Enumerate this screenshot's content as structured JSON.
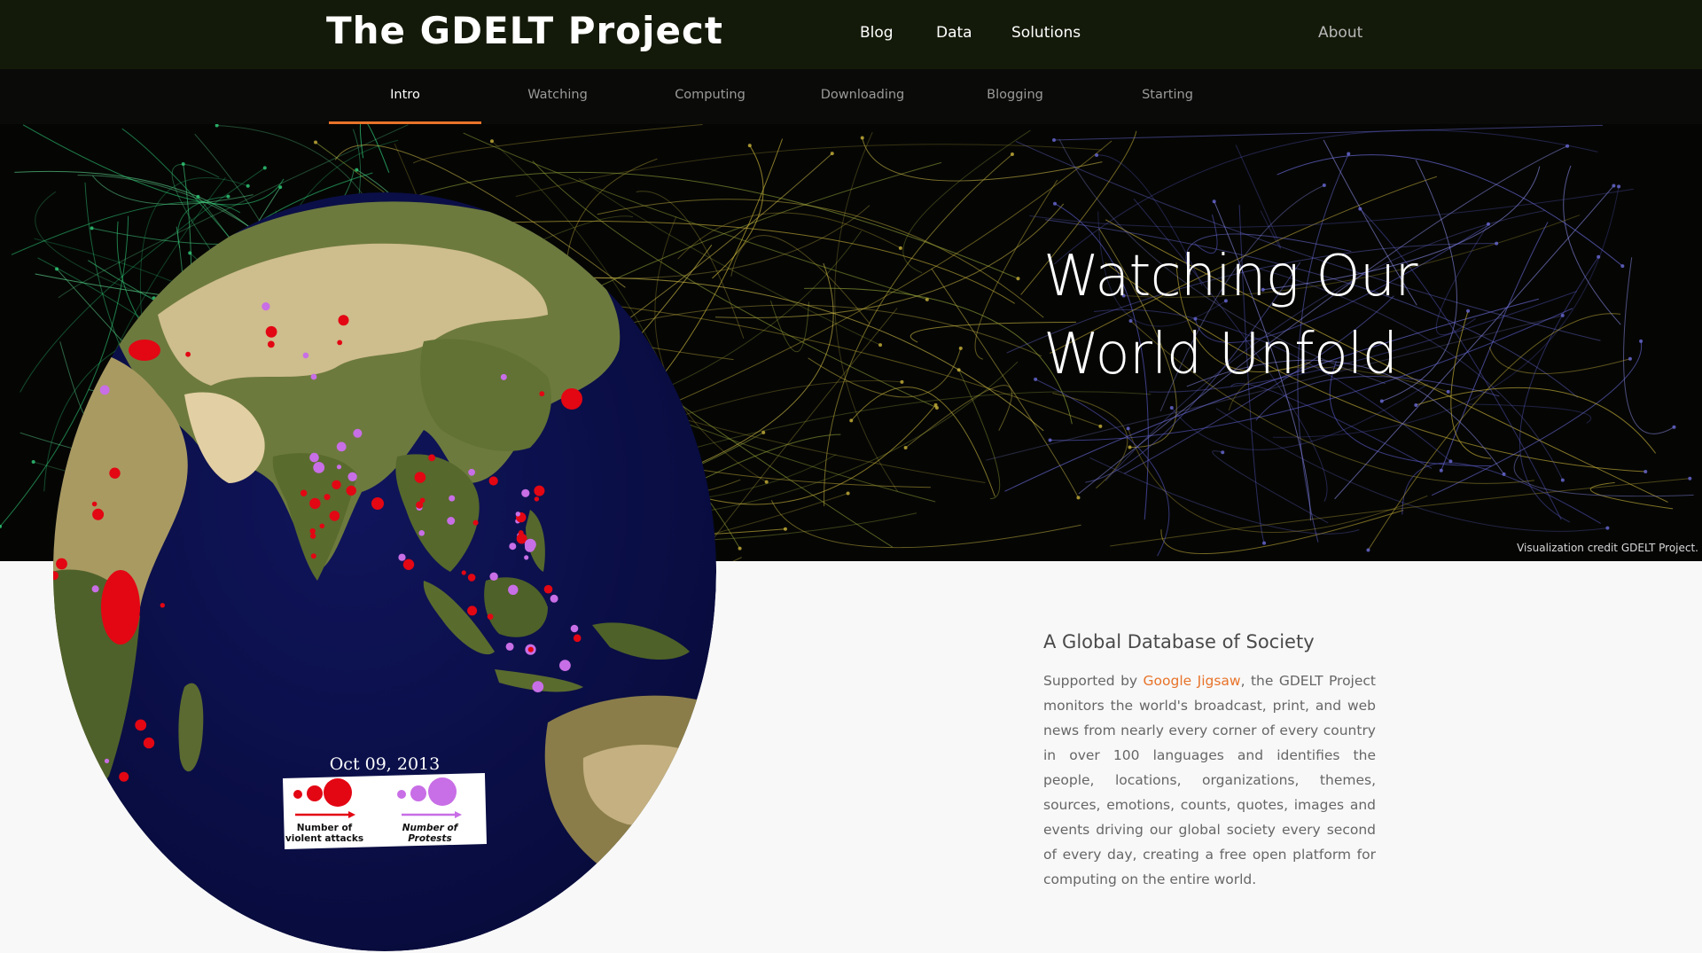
{
  "header": {
    "logo": "The GDELT Project",
    "nav": {
      "blog": "Blog",
      "data": "Data",
      "solutions": "Solutions",
      "about": "About"
    }
  },
  "subnav": {
    "tabs": [
      "Intro",
      "Watching",
      "Computing",
      "Downloading",
      "Blogging",
      "Starting"
    ],
    "active": "Intro"
  },
  "hero": {
    "title_line1": "Watching Our",
    "title_line2": "World Unfold",
    "credit": "Visualization credit GDELT Project."
  },
  "globe": {
    "date": "Oct 09, 2013",
    "legend_attacks": "Number of violent attacks",
    "legend_attacks_l1": "Number of",
    "legend_attacks_l2": "violent attacks",
    "legend_protests_l1": "Number of",
    "legend_protests_l2": "Protests"
  },
  "content": {
    "heading": "A Global Database of Society",
    "body_prefix": "Supported by ",
    "link_text": "Google Jigsaw",
    "body_suffix": ", the GDELT Project monitors the world's broadcast, print, and web news from nearly every corner of every country in over 100 languages and identifies the people, locations, organizations, themes, sources, emotions, counts, quotes, images and events driving our global society every second of every day, creating a free open platform for computing on the entire world."
  },
  "colors": {
    "accent": "#e8732a",
    "topbar": "#141a09",
    "attacks": "#e30613",
    "protests": "#c86ee6",
    "ocean": "#0b0f4a"
  }
}
